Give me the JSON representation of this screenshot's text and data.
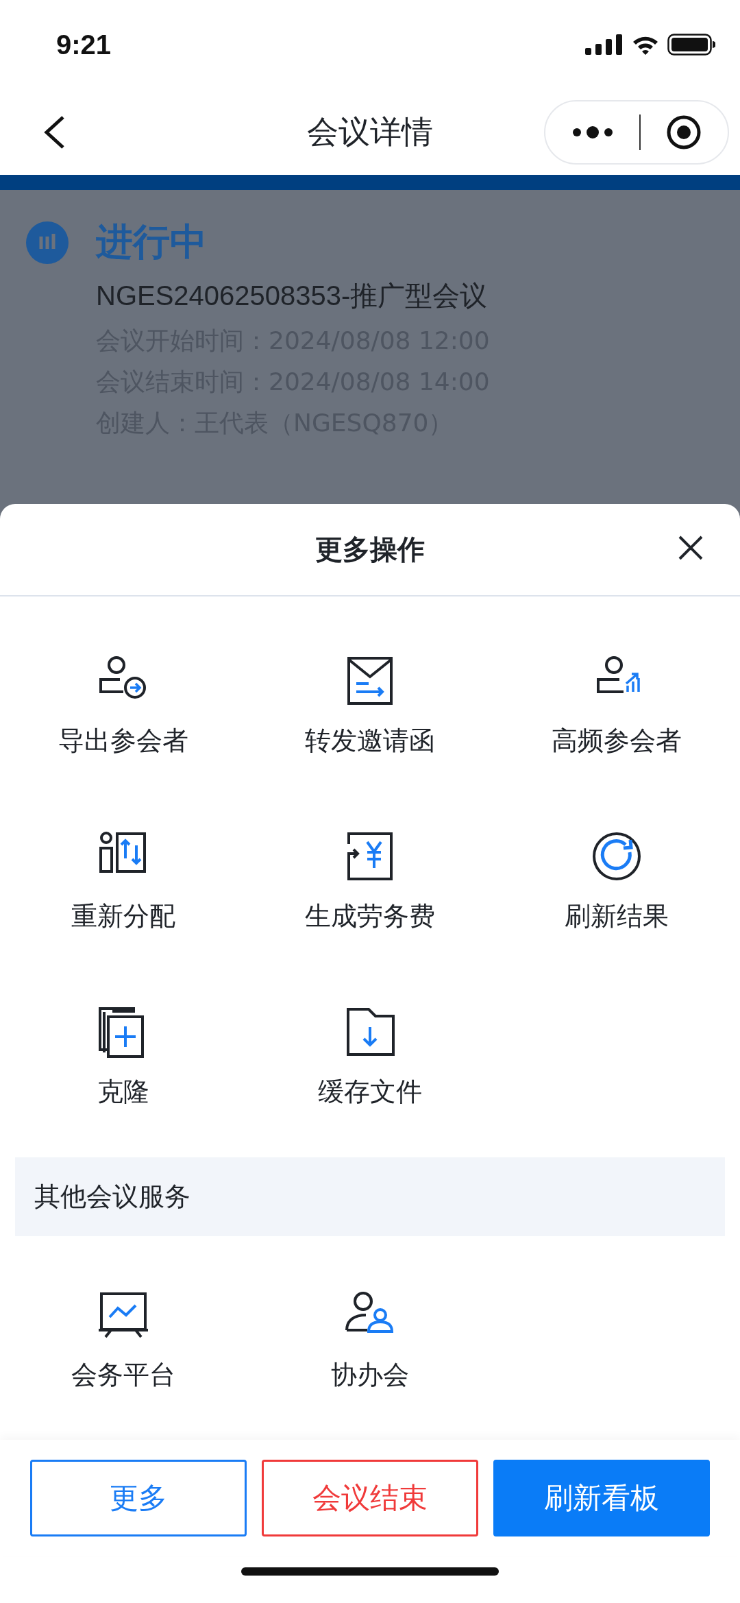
{
  "status_bar": {
    "time": "9:21"
  },
  "nav": {
    "title": "会议详情"
  },
  "meeting": {
    "status": "进行中",
    "title": "NGES24062508353-推广型会议",
    "details": [
      "会议开始时间：2024/08/08 12:00",
      "会议结束时间：2024/08/08 14:00",
      "创建人：王代表（NGESQ870）"
    ]
  },
  "sheet": {
    "title": "更多操作",
    "actions": [
      {
        "label": "导出参会者"
      },
      {
        "label": "转发邀请函"
      },
      {
        "label": "高频参会者"
      },
      {
        "label": "重新分配"
      },
      {
        "label": "生成劳务费"
      },
      {
        "label": "刷新结果"
      },
      {
        "label": "克隆"
      },
      {
        "label": "缓存文件"
      }
    ],
    "section_title": "其他会议服务",
    "services": [
      {
        "label": "会务平台"
      },
      {
        "label": "协办会"
      }
    ]
  },
  "buttons": [
    {
      "label": "更多",
      "kind": "outline"
    },
    {
      "label": "会议结束",
      "kind": "danger"
    },
    {
      "label": "刷新看板",
      "kind": "primary"
    }
  ]
}
